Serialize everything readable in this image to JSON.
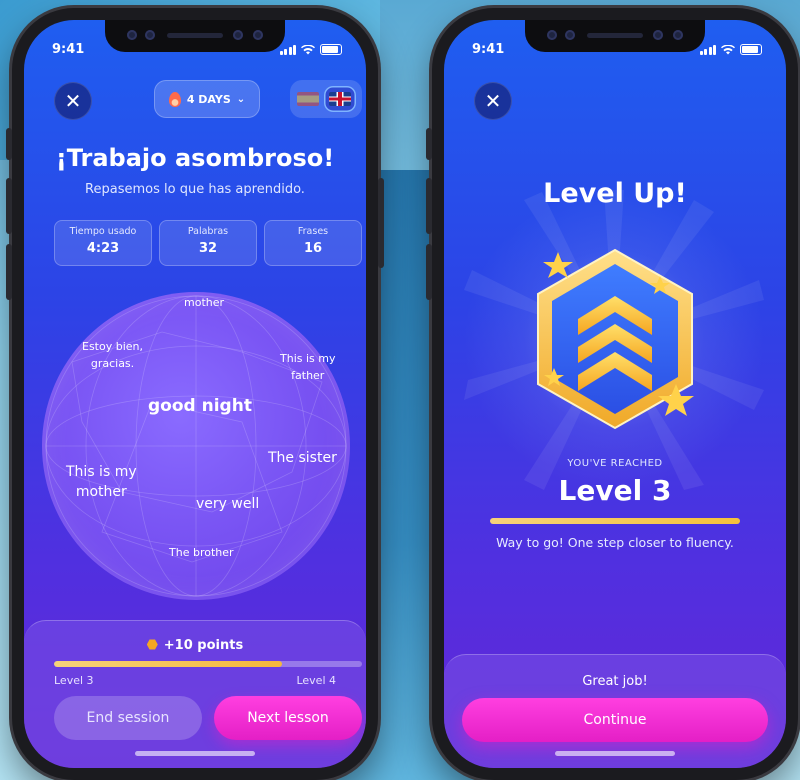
{
  "status_bar": {
    "time": "9:41"
  },
  "lesson_summary": {
    "streak_label": "4 DAYS",
    "title": "¡Trabajo asombroso!",
    "subtitle": "Repasemos lo que has aprendido.",
    "stats": [
      {
        "label": "Tiempo usado",
        "value": "4:23"
      },
      {
        "label": "Palabras",
        "value": "32"
      },
      {
        "label": "Frases",
        "value": "16"
      }
    ],
    "words": [
      "mother",
      "Estoy bien,\ngracias.",
      "This is my\nfather",
      "good night",
      "The sister",
      "This is my\nmother",
      "very well",
      "The brother"
    ],
    "points_label": "+10 points",
    "progress_fraction": 0.74,
    "level_current": "Level 3",
    "level_next": "Level 4",
    "end_button": "End session",
    "next_button": "Next lesson"
  },
  "level_up": {
    "title": "Level Up!",
    "reached_label": "YOU'VE REACHED",
    "level_label": "Level 3",
    "progress_fraction": 1.0,
    "message": "Way to go! One step closer to fluency.",
    "panel_text": "Great job!",
    "continue_button": "Continue"
  },
  "colors": {
    "accent_pink": "#e41fc6",
    "progress_gold": "#f5b73b",
    "bg_blue": "#2d43e6",
    "bg_purple": "#6427d6"
  }
}
